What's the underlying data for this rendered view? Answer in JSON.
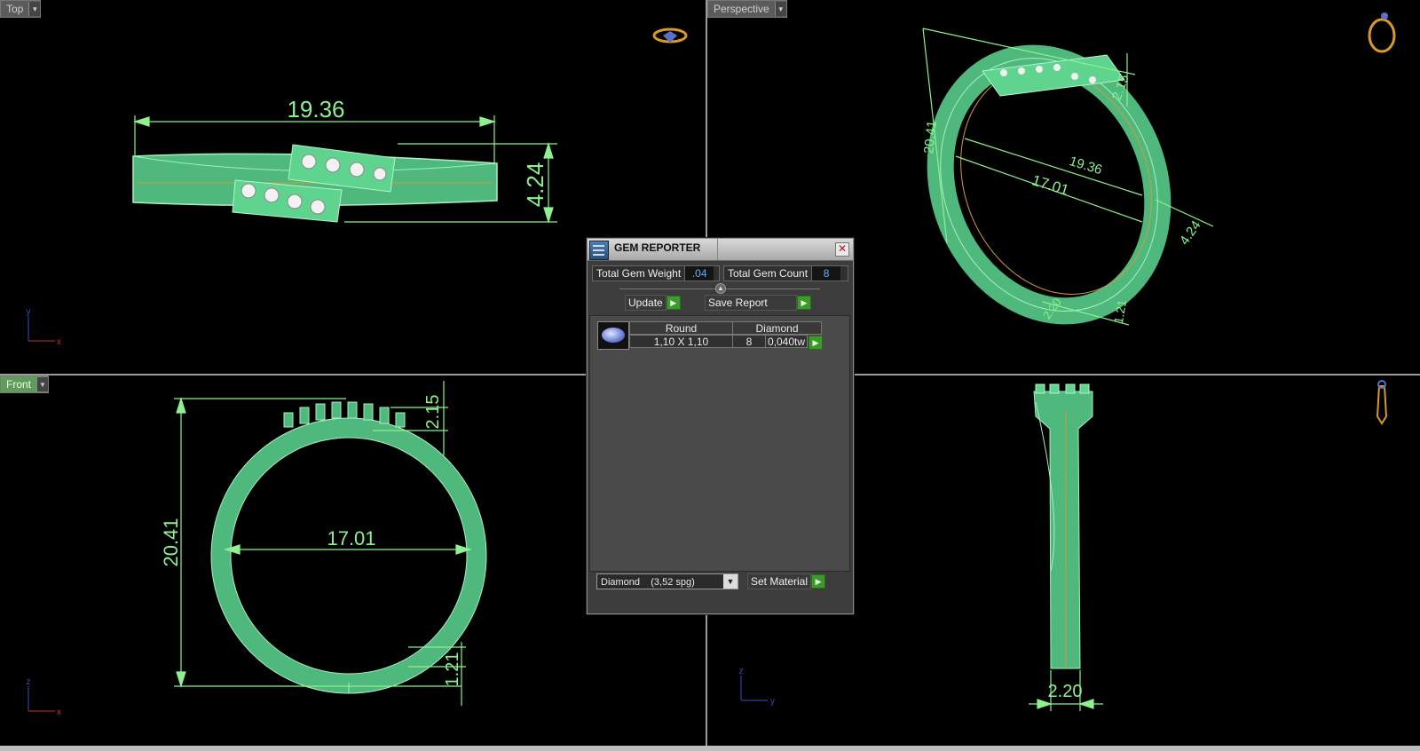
{
  "viewports": {
    "top": {
      "label": "Top",
      "dims": {
        "length": "19.36",
        "height": "4.24"
      },
      "axis_x": "x",
      "axis_y": "y"
    },
    "perspective": {
      "label": "Perspective",
      "dims": {
        "outer": "20.41",
        "length": "19.36",
        "inner": "17.01",
        "top_height": "2.15",
        "side": "4.24",
        "width": "2.20",
        "bottom": "1.21"
      }
    },
    "front": {
      "label": "Front",
      "dims": {
        "outer": "20.41",
        "inner": "17.01",
        "top": "2.15",
        "bottom": "1.21"
      },
      "axis_x": "x",
      "axis_z": "z"
    },
    "right": {
      "label": "",
      "dims": {
        "width": "2.20"
      },
      "axis_y": "y",
      "axis_z": "z"
    }
  },
  "gem_reporter": {
    "title": "GEM REPORTER",
    "total_weight_label": "Total Gem Weight",
    "total_weight_value": ".04",
    "total_count_label": "Total Gem Count",
    "total_count_value": "8",
    "update_label": "Update",
    "save_label": "Save Report",
    "table": {
      "headers": [
        "Round",
        "Diamond"
      ],
      "row": {
        "size": "1,10 X 1,10",
        "count": "8",
        "weight": "0,040tw"
      }
    },
    "material_select": "Diamond    (3,52 spg)",
    "set_material_label": "Set Material"
  },
  "colors": {
    "model": "#5fcf8c",
    "dimension": "#8ef08e",
    "accent": "#3c9a2a"
  }
}
